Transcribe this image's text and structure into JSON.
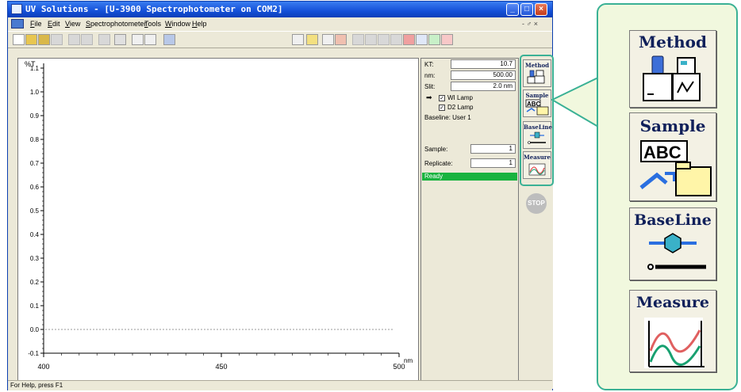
{
  "window": {
    "title": "UV Solutions - [U-3900 Spectrophotometer on COM2]"
  },
  "menu": [
    "File",
    "Edit",
    "View",
    "Spectrophotometer",
    "Tools",
    "Window",
    "Help"
  ],
  "mdi_controls": "- ♂ ×",
  "plot": {
    "ylabel": "%T",
    "xunit": "nm",
    "y_ticks": [
      "1.1",
      "1.0",
      "0.9",
      "0.8",
      "0.7",
      "0.6",
      "0.5",
      "0.4",
      "0.3",
      "0.2",
      "0.1",
      "0.0",
      "-0.1"
    ],
    "x_ticks": [
      "400",
      "450",
      "500"
    ]
  },
  "chart_data": {
    "type": "line",
    "ylabel": "%T",
    "xlabel": "nm",
    "xlim": [
      400,
      500
    ],
    "ylim": [
      -0.1,
      1.1
    ],
    "baseline_y": 0.0,
    "series": []
  },
  "info": {
    "kt_label": "KT:",
    "kt_value": "10.7",
    "nm_label": "nm:",
    "nm_value": "500.00",
    "slit_label": "Slit:",
    "slit_value": "2.0 nm",
    "wi_lamp": "WI Lamp",
    "d2_lamp": "D2 Lamp",
    "baseline": "Baseline: User 1",
    "sample_label": "Sample:",
    "sample_value": "1",
    "replicate_label": "Replicate:",
    "replicate_value": "1",
    "status": "Ready"
  },
  "side_buttons": [
    "Method",
    "Sample",
    "BaseLine",
    "Measure"
  ],
  "stop_label": "STOP",
  "statusbar": "For Help, press F1",
  "callout": {
    "buttons": [
      "Method",
      "Sample",
      "BaseLine",
      "Measure"
    ],
    "sample_icon_text": "ABC"
  },
  "colors": {
    "accent": "#3ab195",
    "ready": "#19b33f",
    "titlebar": "#1450d8"
  }
}
